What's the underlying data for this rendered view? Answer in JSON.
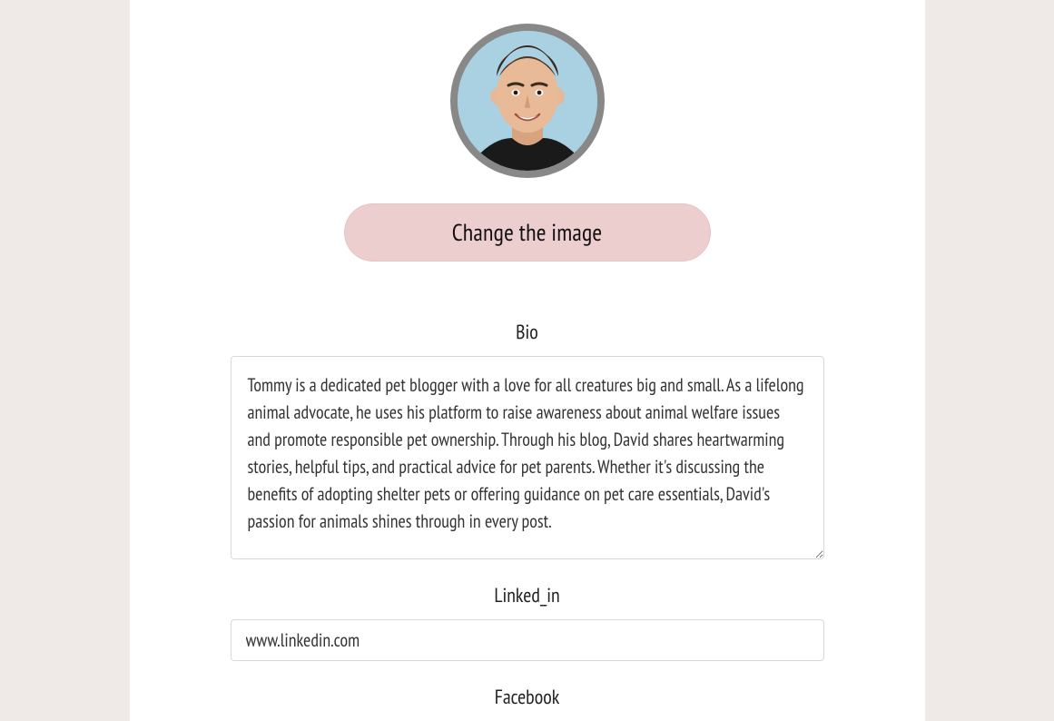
{
  "profile": {
    "change_image_label": "Change the image",
    "bio_label": "Bio",
    "bio_value": "Tommy is a dedicated pet blogger with a love for all creatures big and small. As a lifelong animal advocate, he uses his platform to raise awareness about animal welfare issues and promote responsible pet ownership. Through his blog, David shares heartwarming stories, helpful tips, and practical advice for pet parents. Whether it's discussing the benefits of adopting shelter pets or offering guidance on pet care essentials, David's passion for animals shines through in every post.",
    "linkedin_label": "Linked_in",
    "linkedin_value": "www.linkedin.com",
    "facebook_label": "Facebook"
  }
}
